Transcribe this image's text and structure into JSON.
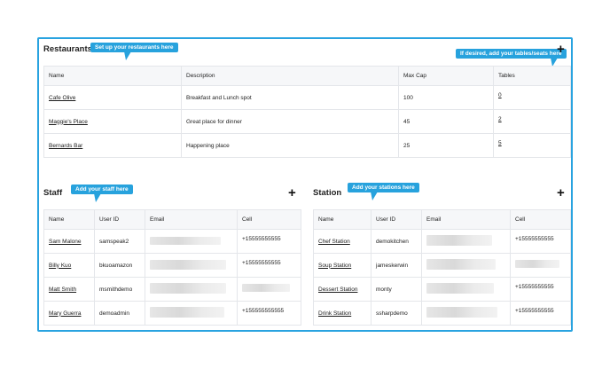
{
  "restaurants": {
    "title": "Restaurants",
    "tip": "Set up your restaurants here",
    "tables_tip": "If desired, add your tables/seats here",
    "add_label": "+",
    "headers": [
      "Name",
      "Description",
      "Max Cap",
      "Tables"
    ],
    "rows": [
      {
        "name": "Cafe Olive",
        "description": "Breakfast and Lunch spot",
        "max_cap": "100",
        "tables": "0"
      },
      {
        "name": "Maggie's Place",
        "description": "Great place for dinner",
        "max_cap": "45",
        "tables": "2"
      },
      {
        "name": "Bernards Bar",
        "description": "Happening place",
        "max_cap": "25",
        "tables": "5"
      }
    ]
  },
  "staff": {
    "title": "Staff",
    "tip": "Add your staff here",
    "add_label": "+",
    "headers": [
      "Name",
      "User ID",
      "Email",
      "Cell"
    ],
    "rows": [
      {
        "name": "Sam Malone",
        "user_id": "samspeak2",
        "cell": "+15555555555"
      },
      {
        "name": "Billy Kuo",
        "user_id": "bkuoamazon",
        "cell": "+15555555555"
      },
      {
        "name": "Matt Smith",
        "user_id": "msmithdemo",
        "cell": ""
      },
      {
        "name": "Mary Guerra",
        "user_id": "demoadmin",
        "cell": "+155555555555"
      }
    ]
  },
  "station": {
    "title": "Station",
    "tip": "Add your stations here",
    "add_label": "+",
    "headers": [
      "Name",
      "User ID",
      "Email",
      "Cell"
    ],
    "rows": [
      {
        "name": "Chef Station",
        "user_id": "demokitchen",
        "cell": "+15555555555"
      },
      {
        "name": "Soup Station",
        "user_id": "jameskerwin",
        "cell": ""
      },
      {
        "name": "Dessert Station",
        "user_id": "monty",
        "cell": "+15555555555"
      },
      {
        "name": "Drink Station",
        "user_id": "ssharpdemo",
        "cell": "+15555555555"
      }
    ]
  },
  "colors": {
    "accent": "#29a3e0",
    "tooltip": "#27a2dd",
    "header_bg": "#f6f7f9"
  }
}
